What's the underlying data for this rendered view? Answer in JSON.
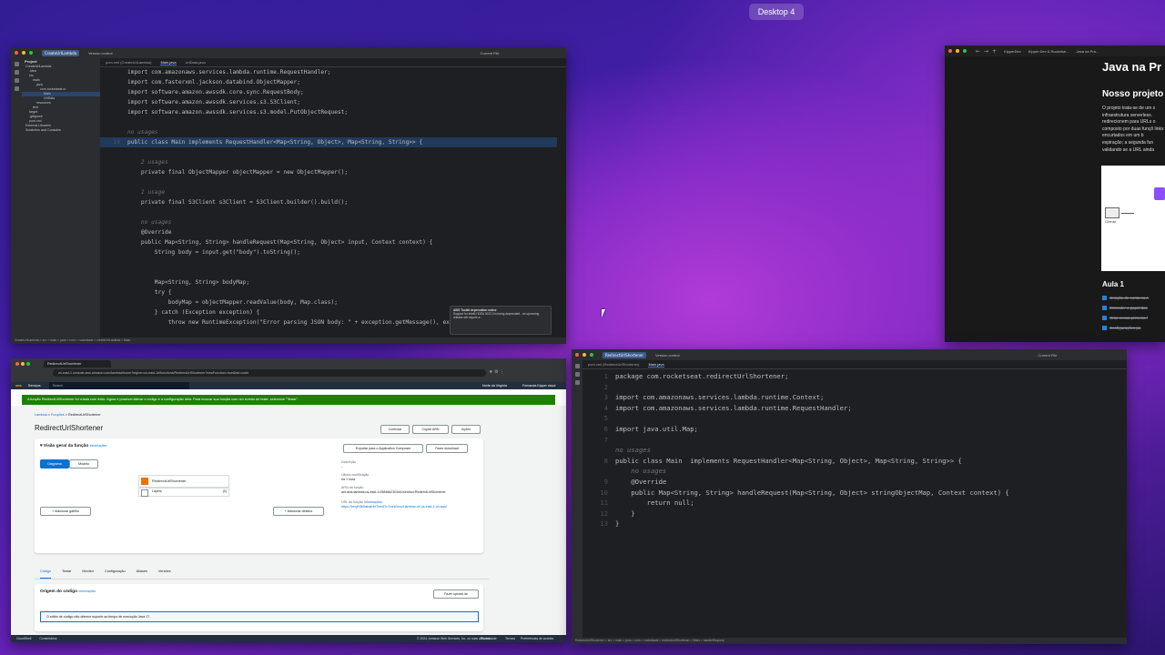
{
  "desktop": {
    "label": "Desktop 4"
  },
  "ide1": {
    "project_name": "CreateUrlLambda",
    "vcs": "Version control",
    "run_config": "Current File",
    "tabs": [
      "pom.xml (CreateUrlLambda)",
      "Main.java",
      "UrlData.java"
    ],
    "panel_title": "Project",
    "tree": [
      "CreateUrlLambda",
      ".idea",
      "src",
      "main",
      "java",
      "com.rocketseat.cr",
      "Main",
      "UrlData",
      "resources",
      "test",
      "target",
      ".gitignore",
      "pom.xml",
      "External Libraries",
      "Scratches and Consoles"
    ],
    "lines": [
      {
        "n": "",
        "t": "import com.amazonaws.services.lambda.runtime.RequestHandler;"
      },
      {
        "n": "",
        "t": "import com.fasterxml.jackson.databind.ObjectMapper;"
      },
      {
        "n": "",
        "t": "import software.amazon.awssdk.core.sync.RequestBody;"
      },
      {
        "n": "",
        "t": "import software.amazon.awssdk.services.s3.S3Client;"
      },
      {
        "n": "",
        "t": "import software.amazon.awssdk.services.s3.model.PutObjectRequest;"
      },
      {
        "n": "",
        "t": ""
      },
      {
        "n": "",
        "t": "no usages",
        "hint": true
      },
      {
        "n": "14",
        "t": "public class Main implements RequestHandler<Map<String, Object>, Map<String, String>> {",
        "hl": true
      },
      {
        "n": "",
        "t": ""
      },
      {
        "n": "",
        "t": "    2 usages",
        "hint": true
      },
      {
        "n": "",
        "t": "    private final ObjectMapper objectMapper = new ObjectMapper();"
      },
      {
        "n": "",
        "t": ""
      },
      {
        "n": "",
        "t": "    1 usage",
        "hint": true
      },
      {
        "n": "",
        "t": "    private final S3Client s3Client = S3Client.builder().build();"
      },
      {
        "n": "",
        "t": ""
      },
      {
        "n": "",
        "t": "    no usages",
        "hint": true
      },
      {
        "n": "",
        "t": "    @Override"
      },
      {
        "n": "",
        "t": "    public Map<String, String> handleRequest(Map<String, Object> input, Context context) {"
      },
      {
        "n": "",
        "t": "        String body = input.get(\"body\").toString();"
      },
      {
        "n": "",
        "t": ""
      },
      {
        "n": "",
        "t": ""
      },
      {
        "n": "",
        "t": "        Map<String, String> bodyMap;"
      },
      {
        "n": "",
        "t": "        try {"
      },
      {
        "n": "",
        "t": "            bodyMap = objectMapper.readValue(body, Map.class);"
      },
      {
        "n": "",
        "t": "        } catch (Exception exception) {"
      },
      {
        "n": "",
        "t": "            throw new RuntimeException(\"Error parsing JSON body: \" + exception.getMessage(), exception);"
      }
    ],
    "notification": {
      "title": "AWS Toolkit deprecation notice",
      "body": "Support for IntelliJ IDEA 2023.3 is being deprecated - an upcoming release will require a..."
    },
    "status": "CreateUrlLambda > src > main > java > com > rocketseat > createUrlLambda > Main"
  },
  "notes": {
    "tabs": [
      "KipperDev",
      "Kipper Dev & Rocketse...",
      "Java na Prá..."
    ],
    "heading": "Java na Pr",
    "subheading": "Nosso projeto",
    "paragraph": "O projeto trata-se de um s infraestrutura serverless. redirecionem para URLs o composto por duas funçõ links encurtados em um b expiração; a segunda fun validando se a URL ainda",
    "aula": "Aula 1",
    "checklist": [
      "Criação de conta na A",
      "Entender o papel das",
      "Criar nossa primeira f",
      "Configurações pa"
    ],
    "diagram_label": "Cliente"
  },
  "aws": {
    "tab_title": "RedirectUrlShortener",
    "url": "us-east-1.console.aws.amazon.com/lambda/home?region=us-east-1#/functions/RedirectUrlShortener?newFunction=true&tab=code",
    "nav_services": "Serviços",
    "nav_search": "Search",
    "nav_region": "Norte da Virgínia",
    "nav_user": "Fernanda Kipper cloud",
    "banner": "A função RedirectUrlShortener foi criada com êxito. Agora é possível alterar o código e a configuração dela. Para invocar sua função com um evento de teste, selecione \"Testar\".",
    "breadcrumb": [
      "Lambda",
      "Funções",
      "RedirectUrlShortener"
    ],
    "title": "RedirectUrlShortener",
    "btn_limitar": "Controlar",
    "btn_copiar": "Copiar ARN",
    "btn_acoes": "Ações",
    "overview_title": "Visão geral da função",
    "overview_info": "Informações",
    "btn_export": "Exportar para o Application Composer",
    "btn_download": "Fazer download",
    "toggle_diagram": "Diagrama",
    "toggle_modelo": "Modelo",
    "fn_name": "RedirectUrlShortener",
    "layers": "Layers",
    "layers_count": "(0)",
    "add_trigger": "+ Adicionar gatilho",
    "add_dest": "+ Adicionar destino",
    "desc_label": "Descrição",
    "desc_value": "-",
    "last_mod_label": "Última modificação",
    "last_mod_value": "há 1 hora",
    "arn_label": "ARN da função",
    "arn_value": "arn:aws:lambda:us-east-1:058466230344:function:RedirectUrlShortener",
    "furl_label": "URL da função",
    "furl_info": "Informações",
    "furl_value": "https://lreqlb3ib5abab4e7hm67u7rnhi0xmzi.lambda-url.us-east-1.on.aws/",
    "tabs": [
      "Código",
      "Testar",
      "Monitor",
      "Configuração",
      "Aliases",
      "Versões"
    ],
    "code_source": "Origem do código",
    "code_info": "Informações",
    "upload_btn": "Fazer upload de",
    "info_box": "O editor de código não oferece suporte ao tempo de execução Java 17.",
    "footer_left": "CloudShell",
    "footer_feedback": "Comentários",
    "footer_copy": "© 2024, Amazon Web Services, Inc. ou suas afiliadas.",
    "footer_links": [
      "Privacidade",
      "Termos",
      "Preferências de cookies"
    ]
  },
  "ide2": {
    "project_name": "RedirectUrlShortener",
    "vcs": "Version control",
    "run_config": "Current File",
    "tabs": [
      "pom.xml (RedirectUrlShortener)",
      "Main.java"
    ],
    "lines": [
      {
        "n": "1",
        "t": "package com.rocketseat.redirectUrlShortener;"
      },
      {
        "n": "2",
        "t": ""
      },
      {
        "n": "3",
        "t": "import com.amazonaws.services.lambda.runtime.Context;"
      },
      {
        "n": "4",
        "t": "import com.amazonaws.services.lambda.runtime.RequestHandler;"
      },
      {
        "n": "5",
        "t": ""
      },
      {
        "n": "6",
        "t": "import java.util.Map;"
      },
      {
        "n": "7",
        "t": ""
      },
      {
        "n": "",
        "t": "no usages",
        "hint": true
      },
      {
        "n": "8",
        "t": "public class Main  implements RequestHandler<Map<String, Object>, Map<String, String>> {"
      },
      {
        "n": "",
        "t": "    no usages",
        "hint": true
      },
      {
        "n": "9",
        "t": "    @Override"
      },
      {
        "n": "10",
        "t": "    public Map<String, String> handleRequest(Map<String, Object> stringObjectMap, Context context) {"
      },
      {
        "n": "11",
        "t": "        return null;"
      },
      {
        "n": "12",
        "t": "    }"
      },
      {
        "n": "13",
        "t": "}"
      }
    ],
    "status": "RedirectUrlShortener > src > main > java > com > rocketseat > redirectUrlShortener > Main > handleRequest"
  }
}
